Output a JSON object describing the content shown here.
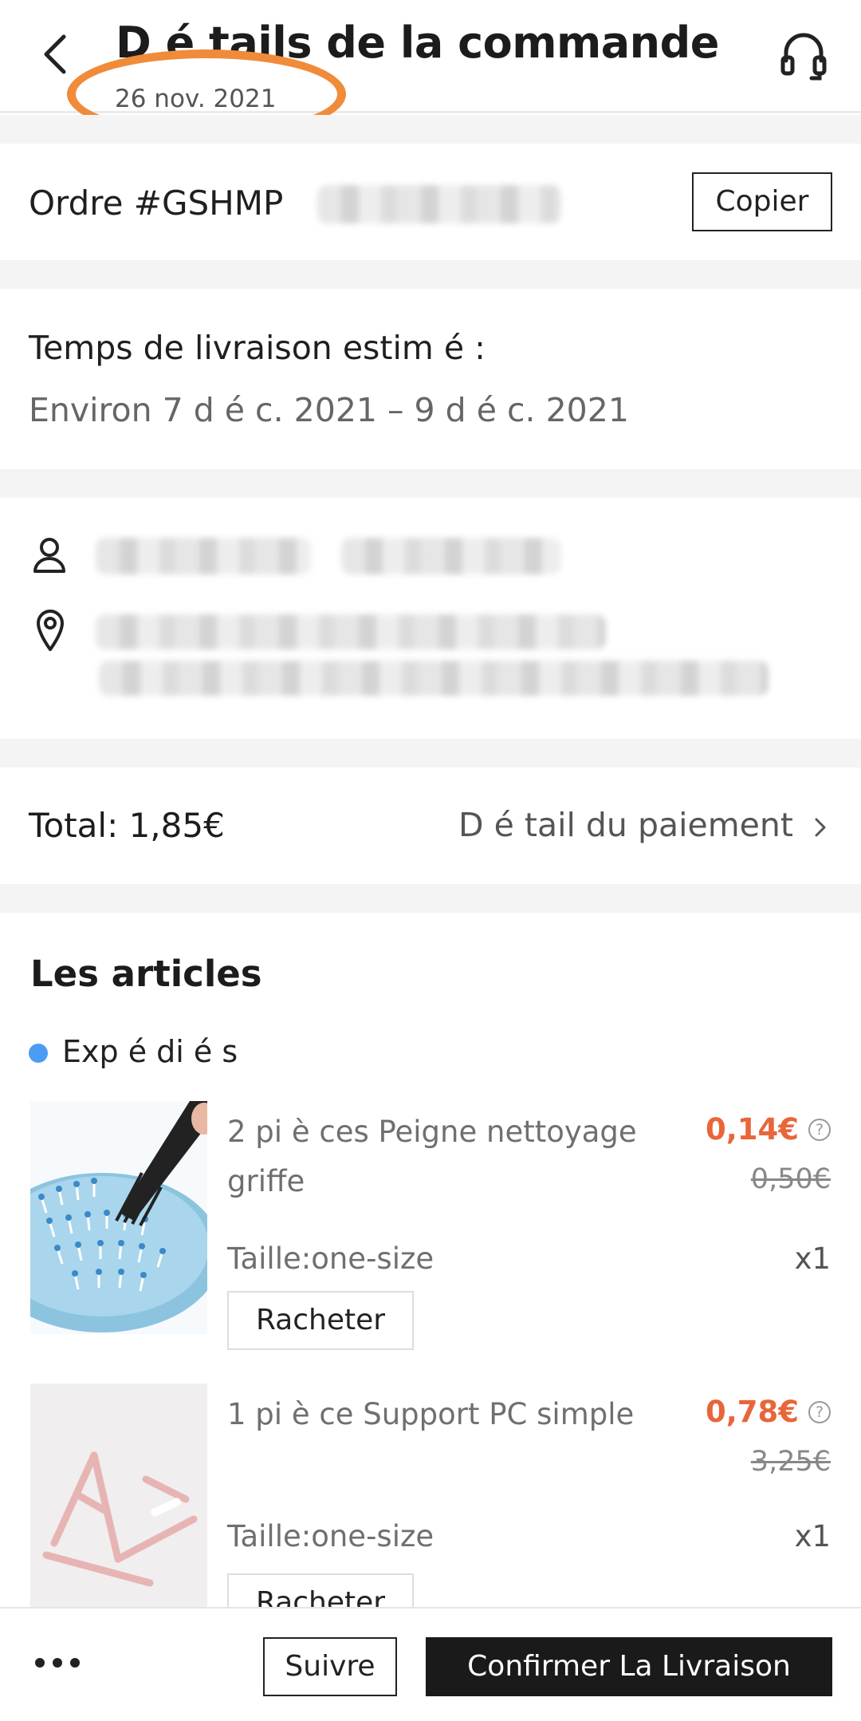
{
  "header": {
    "back_icon": "chevron-left-icon",
    "title": "D é tails de la commande",
    "date": "26 nov. 2021",
    "support_icon": "headset-icon"
  },
  "order": {
    "label": "Ordre #GSHMP",
    "copy_label": "Copier"
  },
  "delivery": {
    "label": "Temps de livraison estim é :",
    "value": "Environ 7 d é c. 2021 – 9 d é c. 2021"
  },
  "address": {
    "user_icon": "user-icon",
    "location_icon": "location-pin-icon"
  },
  "totals": {
    "total": "Total: 1,85€",
    "payment_link": "D é tail du paiement"
  },
  "articles": {
    "title": "Les articles",
    "status": "Exp é di é s",
    "status_color": "#4a9cf4",
    "items": [
      {
        "name": "2 pi è ces Peigne nettoyage griffe",
        "price": "0,14€",
        "old_price": "0,50€",
        "size": "Taille:one-size",
        "qty": "x1",
        "rebuy": "Racheter"
      },
      {
        "name": "1 pi è ce Support PC simple",
        "price": "0,78€",
        "old_price": "3,25€",
        "size": "Taille:one-size",
        "qty": "x1",
        "rebuy": "Racheter"
      }
    ]
  },
  "bottom": {
    "more_icon": "more-dots-icon",
    "follow": "Suivre",
    "confirm": "Confirmer La Livraison"
  },
  "colors": {
    "price": "#e8663a",
    "annotation": "#f08b3a",
    "primary_button": "#1a1a1a"
  }
}
